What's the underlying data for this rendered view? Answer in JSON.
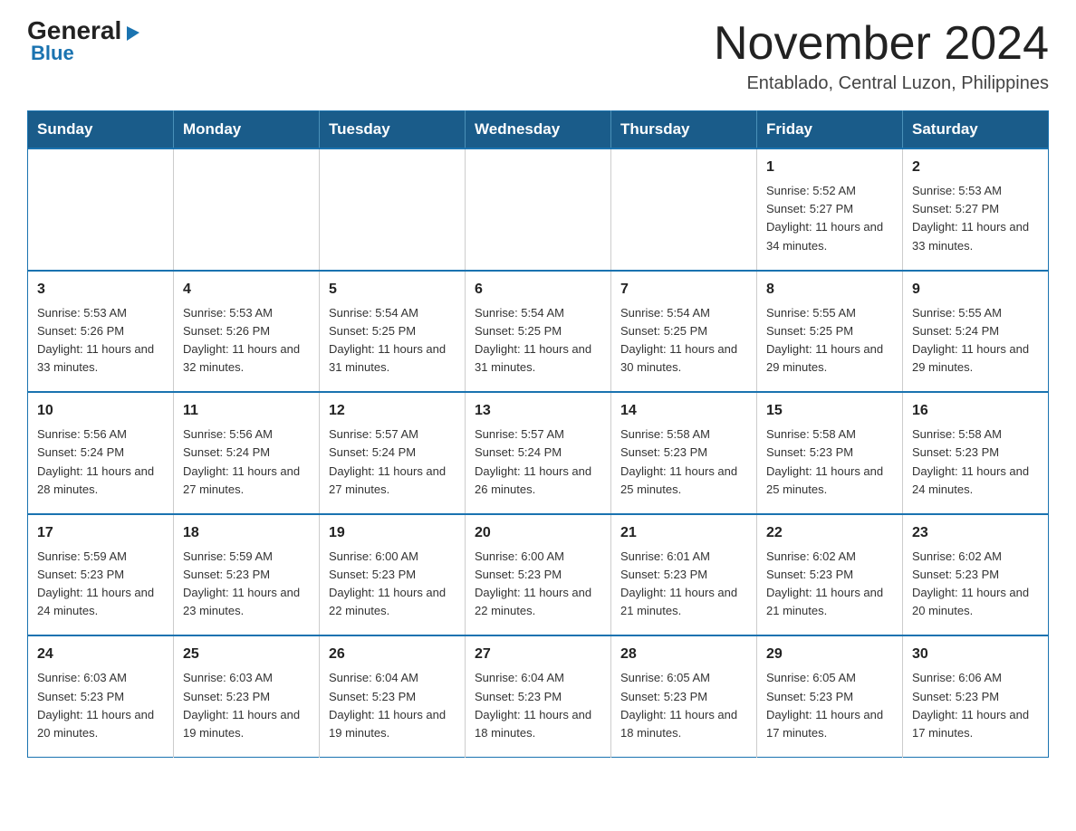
{
  "logo": {
    "general": "General",
    "blue": "Blue",
    "triangle": "▶"
  },
  "title": "November 2024",
  "subtitle": "Entablado, Central Luzon, Philippines",
  "header_days": [
    "Sunday",
    "Monday",
    "Tuesday",
    "Wednesday",
    "Thursday",
    "Friday",
    "Saturday"
  ],
  "weeks": [
    [
      {
        "day": "",
        "info": ""
      },
      {
        "day": "",
        "info": ""
      },
      {
        "day": "",
        "info": ""
      },
      {
        "day": "",
        "info": ""
      },
      {
        "day": "",
        "info": ""
      },
      {
        "day": "1",
        "info": "Sunrise: 5:52 AM\nSunset: 5:27 PM\nDaylight: 11 hours and 34 minutes."
      },
      {
        "day": "2",
        "info": "Sunrise: 5:53 AM\nSunset: 5:27 PM\nDaylight: 11 hours and 33 minutes."
      }
    ],
    [
      {
        "day": "3",
        "info": "Sunrise: 5:53 AM\nSunset: 5:26 PM\nDaylight: 11 hours and 33 minutes."
      },
      {
        "day": "4",
        "info": "Sunrise: 5:53 AM\nSunset: 5:26 PM\nDaylight: 11 hours and 32 minutes."
      },
      {
        "day": "5",
        "info": "Sunrise: 5:54 AM\nSunset: 5:25 PM\nDaylight: 11 hours and 31 minutes."
      },
      {
        "day": "6",
        "info": "Sunrise: 5:54 AM\nSunset: 5:25 PM\nDaylight: 11 hours and 31 minutes."
      },
      {
        "day": "7",
        "info": "Sunrise: 5:54 AM\nSunset: 5:25 PM\nDaylight: 11 hours and 30 minutes."
      },
      {
        "day": "8",
        "info": "Sunrise: 5:55 AM\nSunset: 5:25 PM\nDaylight: 11 hours and 29 minutes."
      },
      {
        "day": "9",
        "info": "Sunrise: 5:55 AM\nSunset: 5:24 PM\nDaylight: 11 hours and 29 minutes."
      }
    ],
    [
      {
        "day": "10",
        "info": "Sunrise: 5:56 AM\nSunset: 5:24 PM\nDaylight: 11 hours and 28 minutes."
      },
      {
        "day": "11",
        "info": "Sunrise: 5:56 AM\nSunset: 5:24 PM\nDaylight: 11 hours and 27 minutes."
      },
      {
        "day": "12",
        "info": "Sunrise: 5:57 AM\nSunset: 5:24 PM\nDaylight: 11 hours and 27 minutes."
      },
      {
        "day": "13",
        "info": "Sunrise: 5:57 AM\nSunset: 5:24 PM\nDaylight: 11 hours and 26 minutes."
      },
      {
        "day": "14",
        "info": "Sunrise: 5:58 AM\nSunset: 5:23 PM\nDaylight: 11 hours and 25 minutes."
      },
      {
        "day": "15",
        "info": "Sunrise: 5:58 AM\nSunset: 5:23 PM\nDaylight: 11 hours and 25 minutes."
      },
      {
        "day": "16",
        "info": "Sunrise: 5:58 AM\nSunset: 5:23 PM\nDaylight: 11 hours and 24 minutes."
      }
    ],
    [
      {
        "day": "17",
        "info": "Sunrise: 5:59 AM\nSunset: 5:23 PM\nDaylight: 11 hours and 24 minutes."
      },
      {
        "day": "18",
        "info": "Sunrise: 5:59 AM\nSunset: 5:23 PM\nDaylight: 11 hours and 23 minutes."
      },
      {
        "day": "19",
        "info": "Sunrise: 6:00 AM\nSunset: 5:23 PM\nDaylight: 11 hours and 22 minutes."
      },
      {
        "day": "20",
        "info": "Sunrise: 6:00 AM\nSunset: 5:23 PM\nDaylight: 11 hours and 22 minutes."
      },
      {
        "day": "21",
        "info": "Sunrise: 6:01 AM\nSunset: 5:23 PM\nDaylight: 11 hours and 21 minutes."
      },
      {
        "day": "22",
        "info": "Sunrise: 6:02 AM\nSunset: 5:23 PM\nDaylight: 11 hours and 21 minutes."
      },
      {
        "day": "23",
        "info": "Sunrise: 6:02 AM\nSunset: 5:23 PM\nDaylight: 11 hours and 20 minutes."
      }
    ],
    [
      {
        "day": "24",
        "info": "Sunrise: 6:03 AM\nSunset: 5:23 PM\nDaylight: 11 hours and 20 minutes."
      },
      {
        "day": "25",
        "info": "Sunrise: 6:03 AM\nSunset: 5:23 PM\nDaylight: 11 hours and 19 minutes."
      },
      {
        "day": "26",
        "info": "Sunrise: 6:04 AM\nSunset: 5:23 PM\nDaylight: 11 hours and 19 minutes."
      },
      {
        "day": "27",
        "info": "Sunrise: 6:04 AM\nSunset: 5:23 PM\nDaylight: 11 hours and 18 minutes."
      },
      {
        "day": "28",
        "info": "Sunrise: 6:05 AM\nSunset: 5:23 PM\nDaylight: 11 hours and 18 minutes."
      },
      {
        "day": "29",
        "info": "Sunrise: 6:05 AM\nSunset: 5:23 PM\nDaylight: 11 hours and 17 minutes."
      },
      {
        "day": "30",
        "info": "Sunrise: 6:06 AM\nSunset: 5:23 PM\nDaylight: 11 hours and 17 minutes."
      }
    ]
  ]
}
